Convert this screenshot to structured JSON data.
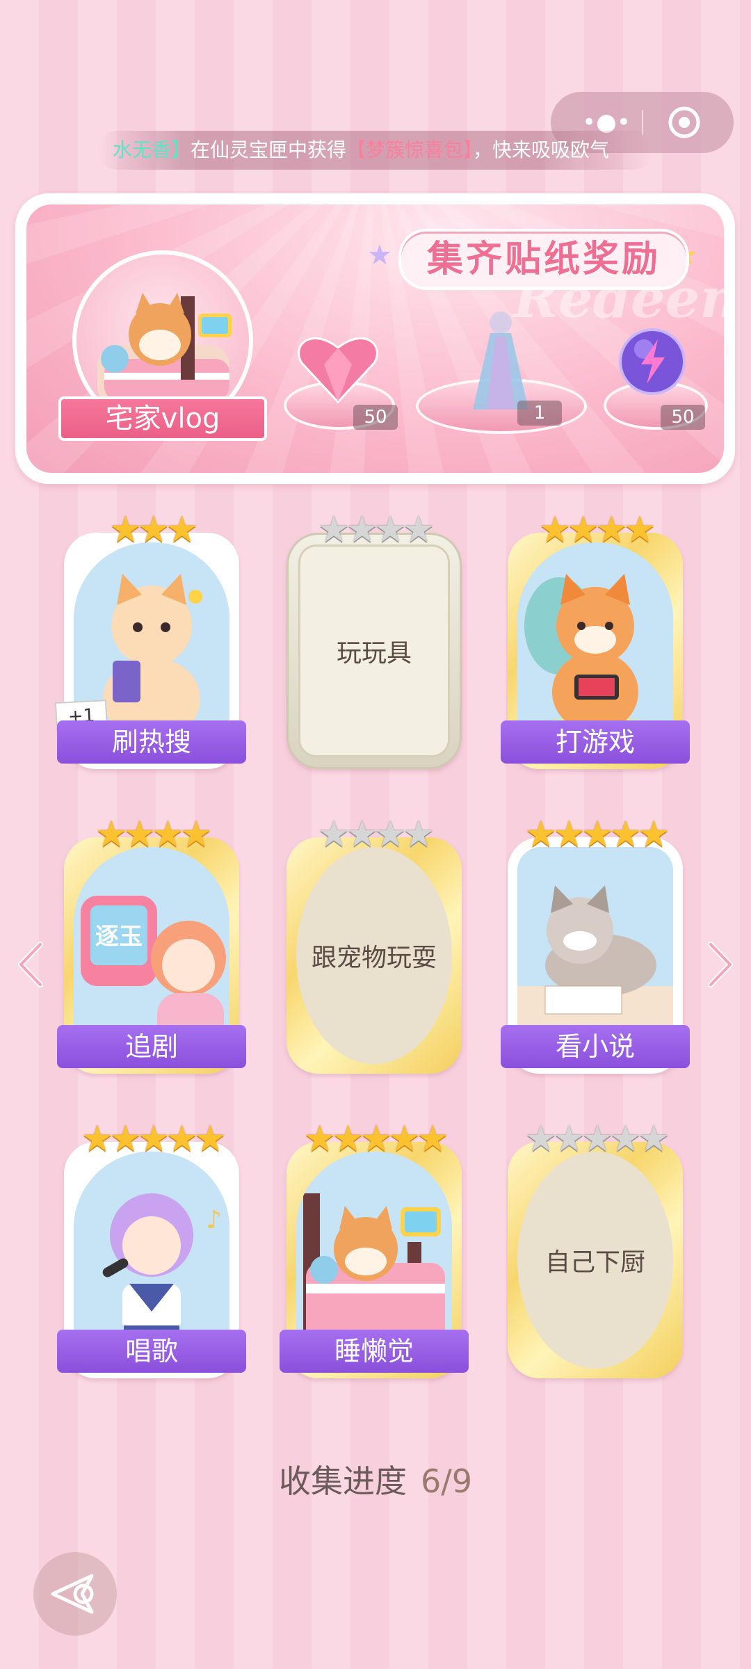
{
  "capsule": {
    "more_icon": "more-dots-icon",
    "close_icon": "target-icon"
  },
  "ticker": {
    "user": "水无香】",
    "pre": "在仙灵宝匣中获得",
    "item": "【梦簇惊喜包】",
    "post": "，快来吸吸欧气"
  },
  "banner": {
    "title": "集齐贴纸奖励",
    "watermark": "Redeem",
    "theme_name": "宅家vlog",
    "rewards": [
      {
        "name": "pink-heart-gem",
        "count": "50"
      },
      {
        "name": "outfit",
        "count": "1"
      },
      {
        "name": "lightning-orb",
        "count": "50"
      }
    ]
  },
  "cards": [
    {
      "label": "刷热搜",
      "stars": 3,
      "collected": true,
      "badge": "+1"
    },
    {
      "label": "玩玩具",
      "stars": 4,
      "collected": false
    },
    {
      "label": "打游戏",
      "stars": 4,
      "collected": true
    },
    {
      "label": "追剧",
      "stars": 4,
      "collected": true,
      "tv_text": "逐玉"
    },
    {
      "label": "跟宠物玩耍",
      "stars": 4,
      "collected": false
    },
    {
      "label": "看小说",
      "stars": 5,
      "collected": true
    },
    {
      "label": "唱歌",
      "stars": 5,
      "collected": true
    },
    {
      "label": "睡懒觉",
      "stars": 5,
      "collected": true
    },
    {
      "label": "自己下厨",
      "stars": 5,
      "collected": false
    }
  ],
  "progress": {
    "label": "收集进度",
    "value": "6/9"
  },
  "colors": {
    "accent_purple": "#8b50db",
    "pink": "#ee6f93",
    "gold_star": "#f9c22e"
  }
}
